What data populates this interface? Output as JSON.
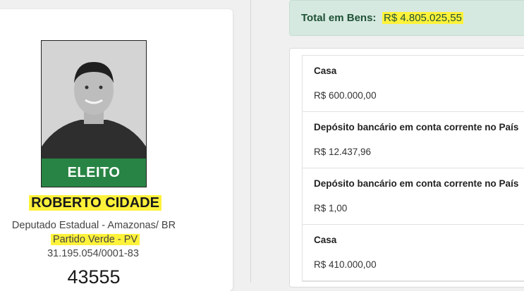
{
  "candidate": {
    "status_badge": "ELEITO",
    "name": "ROBERTO CIDADE",
    "role": "Deputado Estadual - Amazonas/ BR",
    "party": "Partido Verde - PV",
    "cnpj": "31.195.054/0001-83",
    "number": "43555"
  },
  "assets": {
    "total_label": "Total em Bens:",
    "total_value": "R$ 4.805.025,55",
    "items": [
      {
        "title": "Casa",
        "value": "R$ 600.000,00"
      },
      {
        "title": "Depósito bancário em conta corrente no País",
        "value": "R$ 12.437,96"
      },
      {
        "title": "Depósito bancário em conta corrente no País",
        "value": "R$ 1,00"
      },
      {
        "title": "Casa",
        "value": "R$ 410.000,00"
      }
    ]
  },
  "colors": {
    "highlight": "#fff23a",
    "badge_green": "#288c46",
    "total_bg": "#d6e9e0"
  }
}
